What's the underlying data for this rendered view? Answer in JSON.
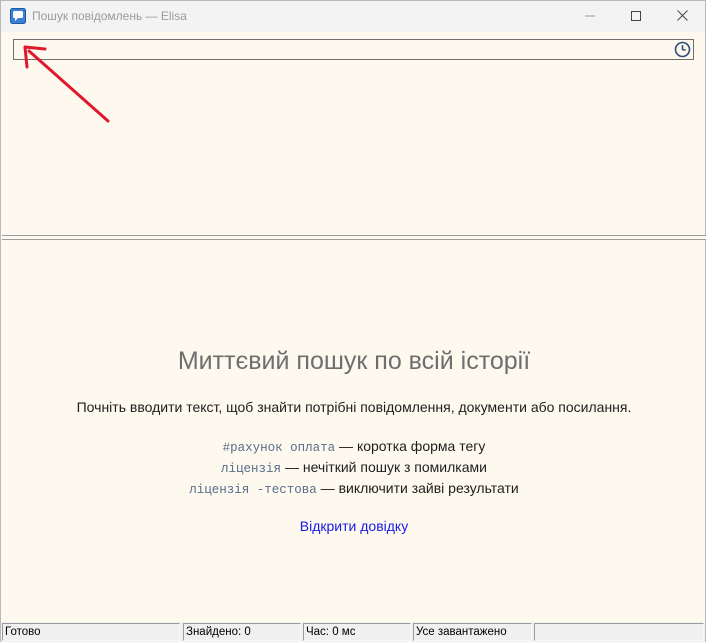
{
  "window": {
    "title": "Пошук повідомлень — Elisa"
  },
  "search": {
    "value": "",
    "placeholder": "",
    "history_icon": "clock-icon"
  },
  "welcome": {
    "title": "Миттєвий пошук по всій історії",
    "lead": "Почніть вводити текст, щоб знайти потрібні повідомлення, документи або посилання.",
    "tips": [
      {
        "code": "#рахунок оплата",
        "text": " — коротка форма тегу"
      },
      {
        "code": "ліцензія",
        "text": " — нечіткий пошук з помилками"
      },
      {
        "code": "ліцензія -тестова",
        "text": " — виключити зайві результати"
      }
    ],
    "help_link": "Відкрити довідку"
  },
  "statusbar": {
    "state": "Готово",
    "found": "Знайдено: 0",
    "time": "Час: 0 мс",
    "loaded": "Усе завантажено",
    "extra": ""
  },
  "colors": {
    "background": "#fdf9ee",
    "link": "#1a1ae6",
    "annotation_arrow": "#e0182d"
  }
}
